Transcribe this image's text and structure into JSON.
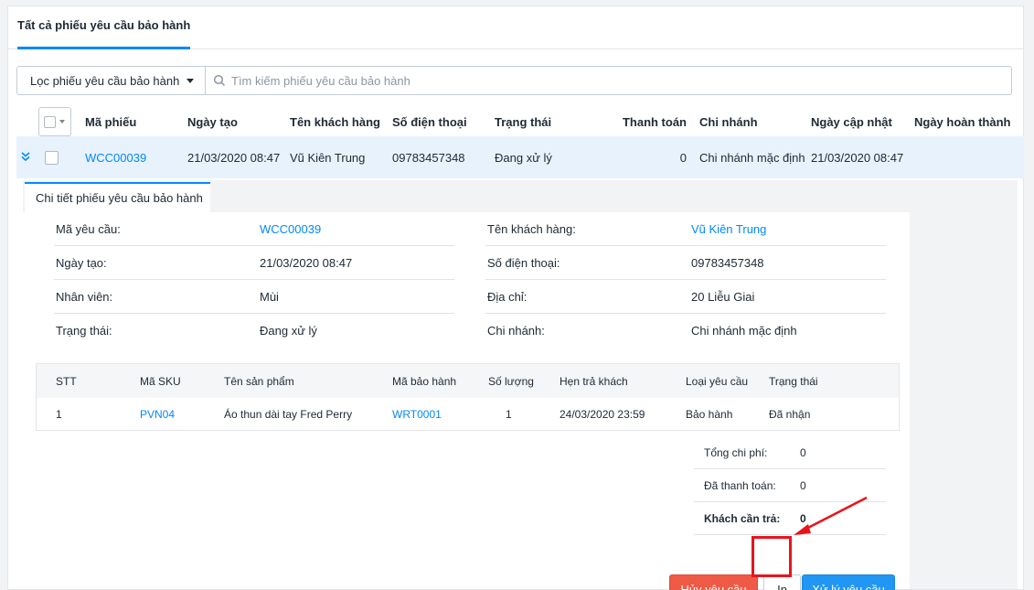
{
  "tabs": {
    "all_requests": "Tất cả phiếu yêu cầu bảo hành"
  },
  "filter": {
    "label": "Lọc phiếu yêu cầu bảo hành"
  },
  "search": {
    "placeholder": "Tìm kiếm phiếu yêu cầu bảo hành"
  },
  "table": {
    "headers": {
      "code": "Mã phiếu",
      "created": "Ngày tạo",
      "customer": "Tên khách hàng",
      "phone": "Số điện thoại",
      "status": "Trạng thái",
      "payment": "Thanh toán",
      "branch": "Chi nhánh",
      "updated": "Ngày cập nhật",
      "completed": "Ngày hoàn thành"
    },
    "row": {
      "code": "WCC00039",
      "created": "21/03/2020 08:47",
      "customer": "Vũ Kiên Trung",
      "phone": "09783457348",
      "status": "Đang xử lý",
      "payment": "0",
      "branch": "Chi nhánh mặc định",
      "updated": "21/03/2020 08:47",
      "completed": ""
    }
  },
  "detail": {
    "tab_label": "Chi tiết phiếu yêu cầu bảo hành",
    "left": {
      "code_label": "Mã yêu cầu:",
      "code_value": "WCC00039",
      "created_label": "Ngày tạo:",
      "created_value": "21/03/2020 08:47",
      "staff_label": "Nhân viên:",
      "staff_value": "Mùi",
      "status_label": "Trạng thái:",
      "status_value": "Đang xử lý"
    },
    "right": {
      "customer_label": "Tên khách hàng:",
      "customer_value": "Vũ Kiên Trung",
      "phone_label": "Số điện thoại:",
      "phone_value": "09783457348",
      "address_label": "Địa chỉ:",
      "address_value": "20 Liễu Giai",
      "branch_label": "Chi nhánh:",
      "branch_value": "Chi nhánh mặc định"
    },
    "items": {
      "headers": {
        "stt": "STT",
        "sku": "Mã SKU",
        "product": "Tên sản phẩm",
        "warranty": "Mã bảo hành",
        "qty": "Số lượng",
        "due": "Hẹn trả khách",
        "type": "Loại yêu cầu",
        "status": "Trạng thái"
      },
      "rows": [
        {
          "stt": "1",
          "sku": "PVN04",
          "product": "Áo thun dài tay Fred Perry",
          "warranty": "WRT0001",
          "qty": "1",
          "due": "24/03/2020 23:59",
          "type": "Bảo hành",
          "status": "Đã nhận"
        }
      ]
    },
    "summary": {
      "total_label": "Tổng chi phí:",
      "total_value": "0",
      "paid_label": "Đã thanh toán:",
      "paid_value": "0",
      "due_label": "Khách cần trả:",
      "due_value": "0"
    },
    "buttons": {
      "cancel": "Hủy yêu cầu",
      "print": "In",
      "process": "Xử lý yêu cầu"
    }
  },
  "colors": {
    "accent": "#0088ff",
    "danger": "#ee5a45",
    "primary": "#2196f3",
    "highlight": "#e8141c",
    "row_selected": "#e8f2fc"
  }
}
